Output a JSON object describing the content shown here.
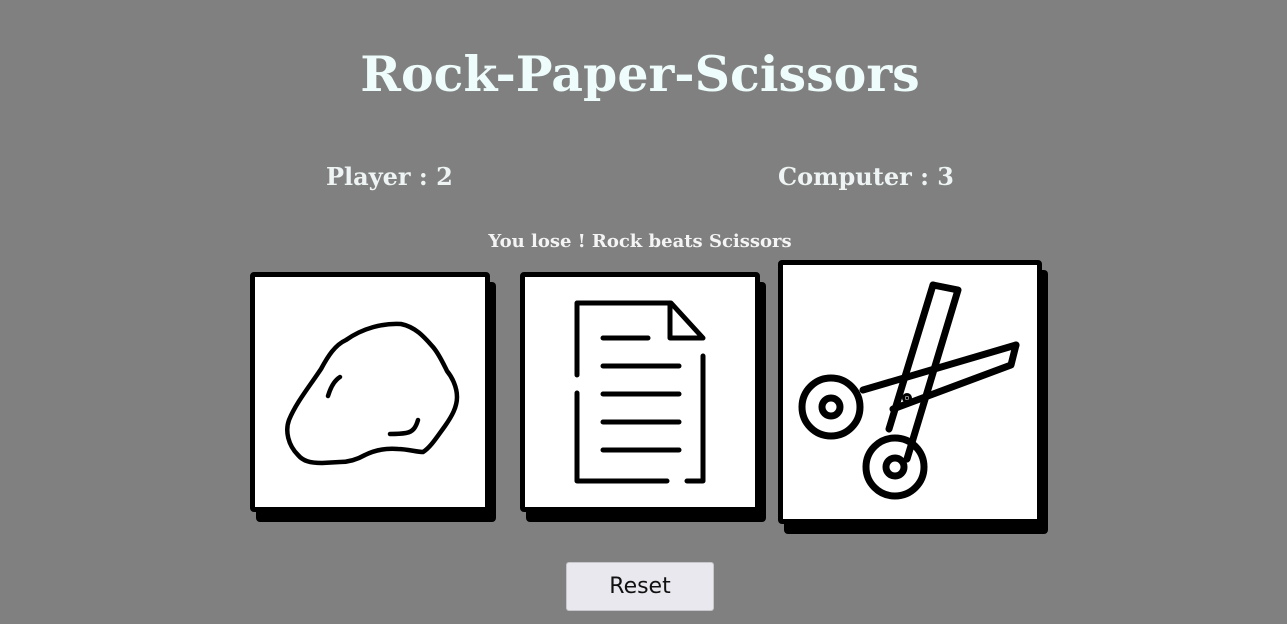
{
  "page": {
    "title": "Rock-Paper-Scissors",
    "background_color": "#808080"
  },
  "scores": {
    "player_text": "Player : 2",
    "computer_text": "Computer : 3"
  },
  "result": {
    "message": "You lose ! Rock beats Scissors"
  },
  "choices": [
    {
      "id": "rock",
      "icon": "rock-icon"
    },
    {
      "id": "paper",
      "icon": "paper-document-icon"
    },
    {
      "id": "scissors",
      "icon": "scissors-icon"
    }
  ],
  "controls": {
    "reset_label": "Reset"
  }
}
